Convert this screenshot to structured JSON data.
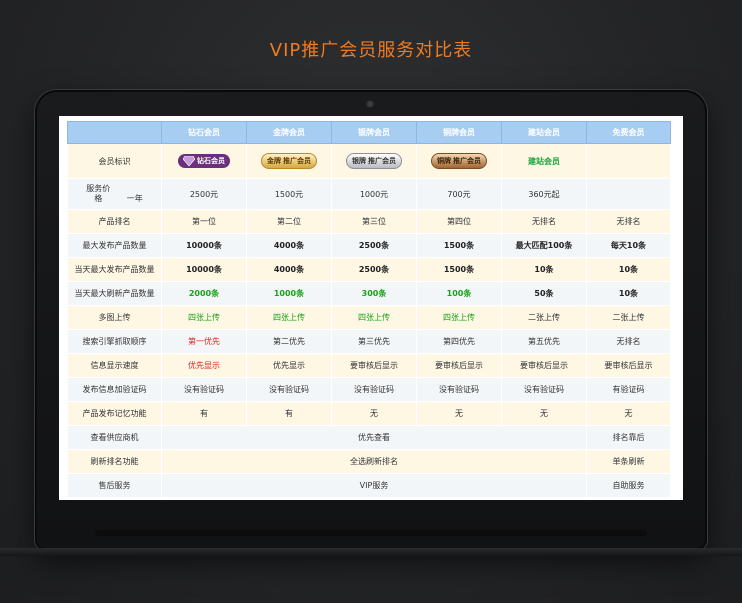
{
  "title": "VIP推广会员服务对比表",
  "header": [
    "",
    "钻石会员",
    "金牌会员",
    "银牌会员",
    "铜牌会员",
    "建站会员",
    "免费会员"
  ],
  "logo_row": {
    "label": "会员标识",
    "diamond": "钻石会员",
    "gold_a": "金牌",
    "gold_b": "推广会员",
    "silver_a": "银牌",
    "silver_b": "推广会员",
    "bronze_a": "铜牌",
    "bronze_b": "推广会员",
    "site": "建站会员"
  },
  "price_row": {
    "label": "服务价格",
    "period": "一年",
    "values": [
      "2500元",
      "1500元",
      "1000元",
      "700元",
      "360元起",
      ""
    ]
  },
  "rows": [
    {
      "label": "产品排名",
      "values": [
        "第一位",
        "第二位",
        "第三位",
        "第四位",
        "无排名",
        "无排名"
      ]
    },
    {
      "label": "最大发布产品数量",
      "values": [
        "10000条",
        "4000条",
        "2500条",
        "1500条",
        "最大匹配100条",
        "每天10条"
      ]
    },
    {
      "label": "当天最大发布产品数量",
      "values": [
        "10000条",
        "4000条",
        "2500条",
        "1500条",
        "10条",
        "10条"
      ]
    },
    {
      "label": "当天最大刷新产品数量",
      "values": [
        "2000条",
        "1000条",
        "300条",
        "100条",
        "50条",
        "10条"
      ]
    },
    {
      "label": "多图上传",
      "values": [
        "四张上传",
        "四张上传",
        "四张上传",
        "四张上传",
        "二张上传",
        "二张上传"
      ]
    },
    {
      "label": "搜索引擎抓取顺序",
      "values": [
        "第一优先",
        "第二优先",
        "第三优先",
        "第四优先",
        "第五优先",
        "无排名"
      ]
    },
    {
      "label": "信息显示速度",
      "values": [
        "优先显示",
        "优先显示",
        "要审核后显示",
        "要审核后显示",
        "要审核后显示",
        "要审核后显示"
      ]
    },
    {
      "label": "发布信息加验证码",
      "values": [
        "没有验证码",
        "没有验证码",
        "没有验证码",
        "没有验证码",
        "没有验证码",
        "有验证码"
      ]
    },
    {
      "label": "产品发布记忆功能",
      "values": [
        "有",
        "有",
        "无",
        "无",
        "无",
        "无"
      ]
    }
  ],
  "span_rows": [
    {
      "label": "查看供应商机",
      "merged": "优先查看",
      "last": "排名靠后"
    },
    {
      "label": "刷新排名功能",
      "merged": "全选刷新排名",
      "last": "单条刷新"
    },
    {
      "label": "售后服务",
      "merged": "VIP服务",
      "last": "自助服务"
    }
  ],
  "colors": {
    "accent": "#f07a1e",
    "header": "#a8cdf2",
    "green": "#16a316",
    "red": "#e2241d"
  }
}
